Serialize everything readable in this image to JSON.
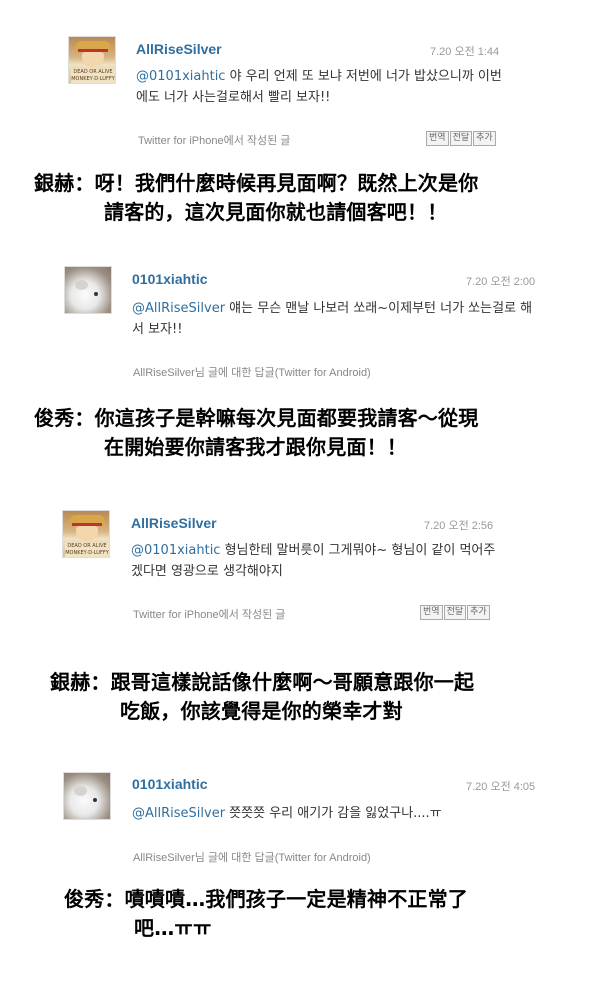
{
  "tweets": [
    {
      "user": "AllRiseSilver",
      "time": "7.20 오전 1:44",
      "mention": "@0101xiahtic",
      "text": " 야 우리 언제 또 보냐 저번에 너가 밥샀으니까 이번에도 너가 사는걸로해서 빨리 보자!!",
      "source": "Twitter for iPhone에서 작성된 글",
      "actions": [
        "번역",
        "전달",
        "추가"
      ],
      "avatar": "onepiece-avatar",
      "avatar_text": "DEAD OR ALIVE\nMONKEY·D·LUFFY"
    },
    {
      "user": "0101xiahtic",
      "time": "7.20 오전 2:00",
      "mention": "@AllRiseSilver",
      "text": " 얘는 무슨 맨날 나보러 쏘래~이제부턴 너가 쏘는걸로 해서 보자!!",
      "source": "AllRiseSilver님 글에 대한 답글(Twitter for Android)",
      "actions": [],
      "avatar": "dog-avatar"
    },
    {
      "user": "AllRiseSilver",
      "time": "7.20 오전 2:56",
      "mention": "@0101xiahtic",
      "text": " 형님한테 말버릇이 그게뭐야~ 형님이 같이 먹어주겠다면 영광으로 생각해야지",
      "source": "Twitter for iPhone에서 작성된 글",
      "actions": [
        "번역",
        "전달",
        "추가"
      ],
      "avatar": "onepiece-avatar",
      "avatar_text": "DEAD OR ALIVE\nMONKEY·D·LUFFY"
    },
    {
      "user": "0101xiahtic",
      "time": "7.20 오전 4:05",
      "mention": "@AllRiseSilver",
      "text": " 쯧쯧쯧 우리 애기가 감을 잃었구나....ㅠ",
      "source": "AllRiseSilver님 글에 대한 답글(Twitter for Android)",
      "actions": [],
      "avatar": "dog-avatar"
    }
  ],
  "captions": [
    {
      "line1": "銀赫：呀！我們什麼時候再見面啊？既然上次是你",
      "line2": "請客的，這次見面你就也請個客吧！！"
    },
    {
      "line1": "俊秀：你這孩子是幹嘛每次見面都要我請客～從現",
      "line2": "在開始要你請客我才跟你見面！！"
    },
    {
      "line1": "銀赫：跟哥這樣說話像什麼啊～哥願意跟你一起",
      "line2": "吃飯，你該覺得是你的榮幸才對"
    },
    {
      "line1": "俊秀：嘖嘖嘖…我們孩子一定是精神不正常了",
      "line2": "吧…ㅠㅠ"
    }
  ],
  "colors": {
    "name": "#2f6e9f",
    "mention": "#2f6e9f",
    "text": "#333333",
    "meta": "#999999",
    "caption": "#000000"
  }
}
